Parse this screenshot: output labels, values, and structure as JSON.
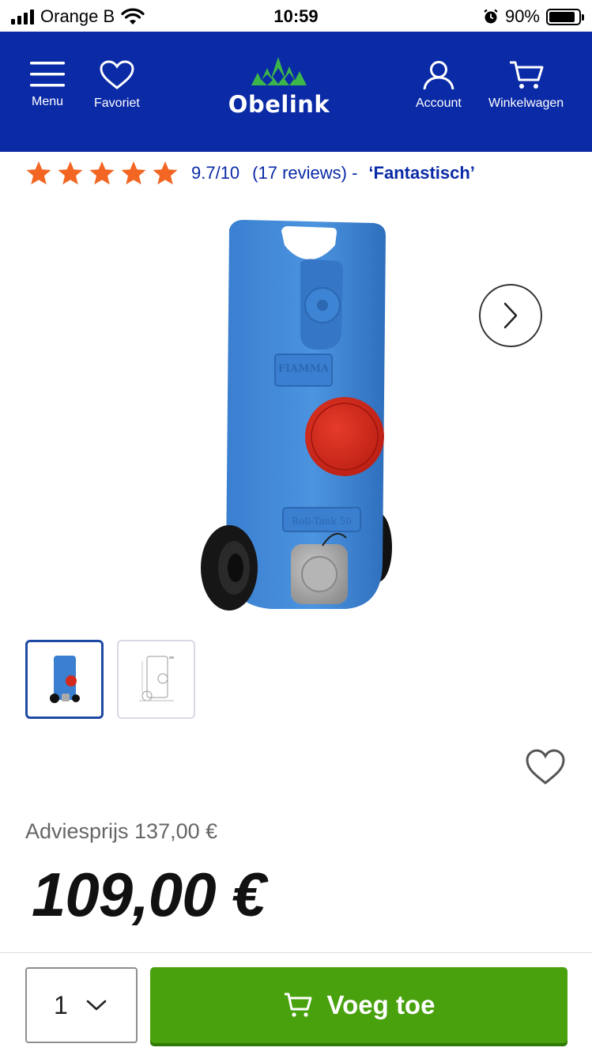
{
  "status_bar": {
    "carrier": "Orange B",
    "time": "10:59",
    "battery": "90%",
    "battery_level": 0.9
  },
  "header": {
    "menu_label": "Menu",
    "favorites_label": "Favoriet",
    "brand": "Obelink",
    "account_label": "Account",
    "cart_label": "Winkelwagen",
    "background_color": "#0a2aa6",
    "logo_accent_color": "#3cb54a"
  },
  "rating": {
    "stars": 5,
    "score": "9.7/10",
    "reviews": "(17 reviews) -",
    "label": "‘Fantastisch’",
    "star_color": "#f26522"
  },
  "gallery": {
    "thumbnail_count": 2,
    "active_index": 0
  },
  "pricing": {
    "advice_label": "Adviesprijs 137,00 €",
    "price": "109,00 €"
  },
  "purchase": {
    "quantity": "1",
    "add_button_label": "Voeg toe",
    "button_color": "#48a10d"
  }
}
